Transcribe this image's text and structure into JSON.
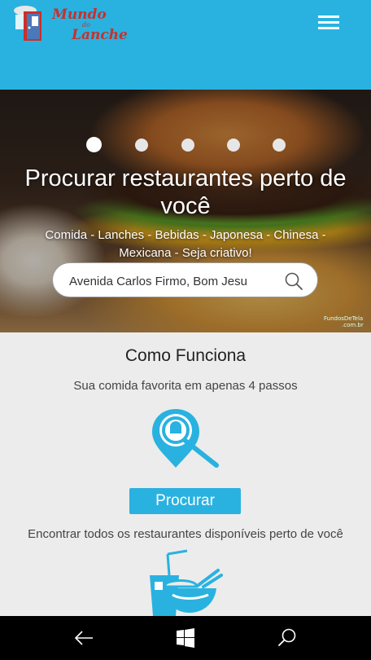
{
  "header": {
    "logo": {
      "line1": "Mundo",
      "line2": "do",
      "line3": "Lanche",
      "icon": "restaurant-door-logo"
    },
    "menu_icon": "hamburger-menu-icon"
  },
  "hero": {
    "carousel": {
      "slide_count": 5,
      "active_index": 0
    },
    "title": "Procurar restaurantes perto de você",
    "subtitle": "Comida - Lanches - Bebidas - Japonesa - Chinesa - Mexicana - Seja criativo!",
    "search": {
      "value": "Avenida Carlos Firmo, Bom Jesu",
      "icon": "search-icon"
    },
    "watermark": {
      "line1": "FundosDeTela",
      "line2": ".com.br"
    }
  },
  "how_it_works": {
    "title": "Como Funciona",
    "subtitle": "Sua comida favorita em apenas 4 passos",
    "step1": {
      "icon": "location-search-icon",
      "button_label": "Procurar",
      "description": "Encontrar todos os restaurantes disponíveis perto de você"
    },
    "step2": {
      "icon": "food-drink-icon"
    }
  },
  "system_nav": {
    "back_icon": "back-arrow-icon",
    "home_icon": "windows-icon",
    "search_icon": "search-icon"
  },
  "colors": {
    "brand_blue": "#29b2e0",
    "logo_red": "#c9302c",
    "background": "#ececec"
  }
}
